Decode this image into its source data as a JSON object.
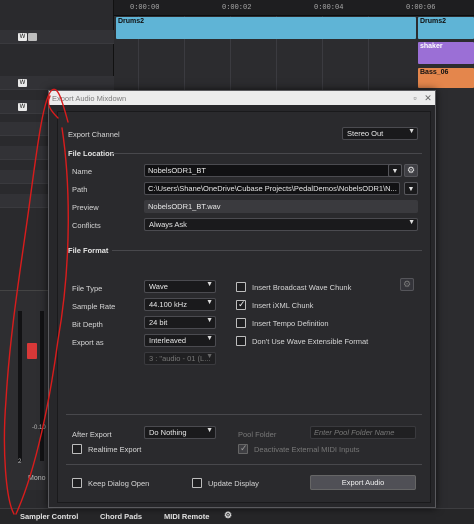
{
  "background": {
    "left_button": "W",
    "timeline_labels": [
      "0:00:00",
      "0:00:02",
      "0:00:04",
      "0:00:06"
    ],
    "clips": [
      {
        "label": "Drums2",
        "color": "#5fb4d6"
      },
      {
        "label": "Drums2",
        "color": "#5fb4d6"
      },
      {
        "label": "shaker",
        "color": "#9b6fd6"
      },
      {
        "label": "Bass_06",
        "color": "#e4864c"
      }
    ],
    "meter_value": "-0.10",
    "meter_label_2": "2",
    "mono_label": "Mono",
    "bottom_tabs": [
      "Sampler Control",
      "Chord Pads",
      "MIDI Remote"
    ]
  },
  "dialog": {
    "title": "Export Audio Mixdown",
    "export_channel_label": "Export Channel",
    "export_channel_value": "Stereo Out",
    "file_location_header": "File Location",
    "name_label": "Name",
    "name_value": "NobelsODR1_BT",
    "path_label": "Path",
    "path_value": "C:\\Users\\Shane\\OneDrive\\Cubase Projects\\PedalDemos\\NobelsODR1\\N...",
    "preview_label": "Preview",
    "preview_value": "NobelsODR1_BT.wav",
    "conflicts_label": "Conflicts",
    "conflicts_value": "Always Ask",
    "file_format_header": "File Format",
    "file_type_label": "File Type",
    "file_type_value": "Wave",
    "sample_rate_label": "Sample Rate",
    "sample_rate_value": "44.100 kHz",
    "bit_depth_label": "Bit Depth",
    "bit_depth_value": "24 bit",
    "export_as_label": "Export as",
    "export_as_value": "Interleaved",
    "channel_assign_value": "3 : \"audio - 01 (L...",
    "insert_bwc_label": "Insert Broadcast Wave Chunk",
    "insert_bwc_checked": false,
    "insert_ixml_label": "Insert iXML Chunk",
    "insert_ixml_checked": true,
    "insert_tempo_label": "Insert Tempo Definition",
    "insert_tempo_checked": false,
    "no_wave_ext_label": "Don't Use Wave Extensible Format",
    "no_wave_ext_checked": false,
    "after_export_label": "After Export",
    "after_export_value": "Do Nothing",
    "pool_folder_label": "Pool Folder",
    "pool_folder_placeholder": "Enter Pool Folder Name",
    "realtime_export_label": "Realtime Export",
    "realtime_export_checked": false,
    "deactivate_midi_label": "Deactivate External MIDI Inputs",
    "deactivate_midi_checked": true,
    "keep_dialog_open_label": "Keep Dialog Open",
    "keep_dialog_open_checked": false,
    "update_display_label": "Update Display",
    "update_display_checked": false,
    "export_button_label": "Export Audio"
  }
}
